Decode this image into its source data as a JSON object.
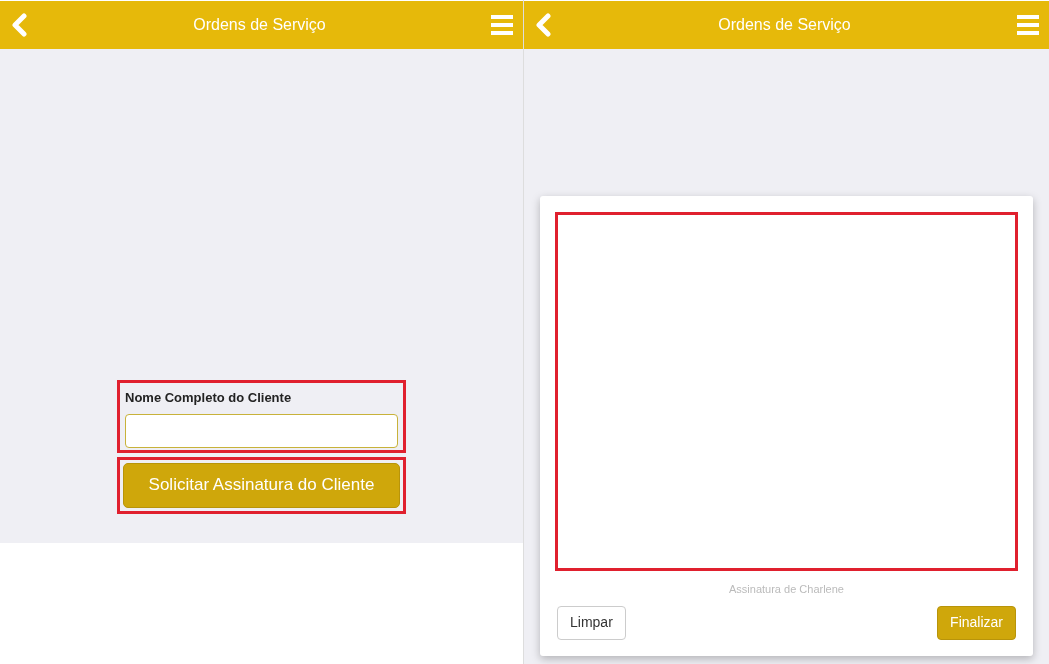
{
  "screens": [
    {
      "kind": "form",
      "header": {
        "title": "Ordens de Serviço"
      },
      "form": {
        "label": "Nome Completo do Cliente",
        "button": "Solicitar Assinatura do Cliente"
      }
    },
    {
      "kind": "signature",
      "header": {
        "title": "Ordens de Serviço"
      },
      "signature": {
        "caption": "Assinatura de Charlene",
        "clear_button": "Limpar",
        "finish_button": "Finalizar"
      }
    }
  ]
}
